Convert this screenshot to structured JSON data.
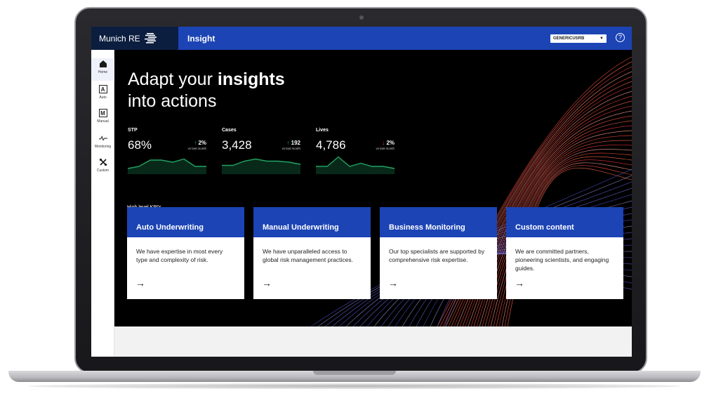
{
  "app": {
    "brand": "Munich RE",
    "title": "Insight",
    "user": "GENERICUSRB",
    "help": "?"
  },
  "sidebar": {
    "items": [
      {
        "label": "Home",
        "icon": "home-icon",
        "glyph": ""
      },
      {
        "label": "Auto",
        "icon": "auto-icon",
        "glyph": "A"
      },
      {
        "label": "Manual",
        "icon": "manual-icon",
        "glyph": "M"
      },
      {
        "label": "Monitoring",
        "icon": "pulse-icon",
        "glyph": ""
      },
      {
        "label": "Custom",
        "icon": "tools-icon",
        "glyph": ""
      }
    ]
  },
  "hero": {
    "title_line1_prefix": "Adapt your",
    "title_line1_bold": "insights",
    "title_line2": "into actions"
  },
  "kpis": [
    {
      "label": "STP",
      "value": "68%",
      "delta": "2%",
      "direction": "up",
      "sub": "vs last month",
      "trend": [
        4,
        6,
        12,
        12,
        10,
        13,
        6,
        6
      ]
    },
    {
      "label": "Cases",
      "value": "3,428",
      "delta": "192",
      "direction": "up",
      "sub": "vs last month",
      "trend": [
        7,
        7,
        11,
        13,
        11,
        11,
        10,
        8
      ]
    },
    {
      "label": "Lives",
      "value": "4,786",
      "delta": "2%",
      "direction": "down",
      "sub": "vs last month",
      "trend": [
        6,
        6,
        15,
        6,
        9,
        6,
        6,
        4
      ]
    }
  ],
  "kpi_link": "High level KPI's",
  "cards": [
    {
      "title": "Auto Underwriting",
      "text": "We have expertise in most every type and complexity of risk."
    },
    {
      "title": "Manual Underwriting",
      "text": "We have unparalleled access to global risk management practices."
    },
    {
      "title": "Business Monitoring",
      "text": "Our top specialists are supported by comprehensive risk expertise."
    },
    {
      "title": "Custom content",
      "text": "We are committed partners, pioneering scientists, and engaging guides."
    }
  ],
  "colors": {
    "topbar": "#1c44b5",
    "brand_block": "#0c1e3f",
    "trend_line": "#1fa463",
    "up": "#22c55e",
    "down": "#ef4444"
  }
}
